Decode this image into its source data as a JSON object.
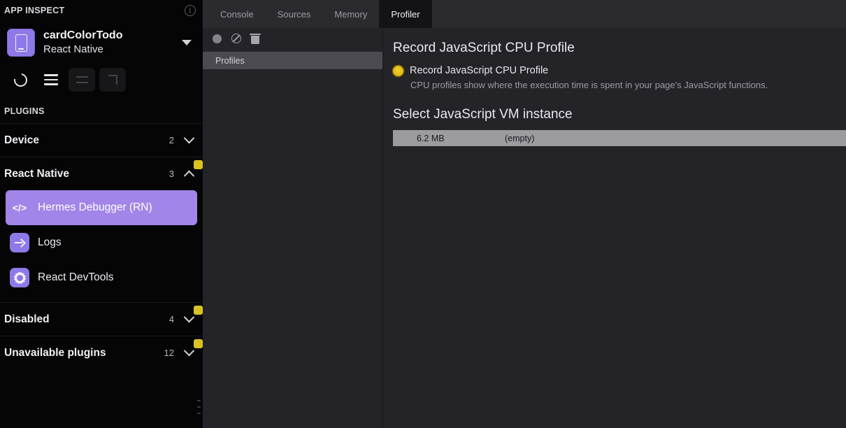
{
  "sidebar": {
    "title": "APP INSPECT",
    "info_icon": "info-icon",
    "app": {
      "name": "cardColorTodo",
      "framework": "React Native",
      "icon": "mobile-device-icon",
      "dropdown_icon": "caret-down-icon"
    },
    "toolbar": [
      {
        "name": "reload-button",
        "icon": "reload-icon",
        "disabled": false
      },
      {
        "name": "menu-button",
        "icon": "hamburger-menu-icon",
        "disabled": false
      },
      {
        "name": "layout-button",
        "icon": "layout-rows-icon",
        "disabled": true
      },
      {
        "name": "screenshot-button",
        "icon": "screen-capture-icon",
        "disabled": true
      }
    ],
    "plugins_label": "PLUGINS",
    "sections": [
      {
        "label": "Device",
        "count": "2",
        "chevron": "down",
        "badge": false
      },
      {
        "label": "React Native",
        "count": "3",
        "chevron": "up",
        "badge": true
      },
      {
        "label": "Disabled",
        "count": "4",
        "chevron": "down",
        "badge": true
      },
      {
        "label": "Unavailable plugins",
        "count": "12",
        "chevron": "down",
        "badge": true
      }
    ],
    "plugins": [
      {
        "label": "Hermes Debugger (RN)",
        "icon": "code-brackets-icon",
        "selected": true
      },
      {
        "label": "Logs",
        "icon": "arrow-right-icon",
        "selected": false
      },
      {
        "label": "React DevTools",
        "icon": "gear-atom-icon",
        "selected": false
      }
    ]
  },
  "devtools": {
    "tabs": [
      {
        "label": "Console",
        "active": false
      },
      {
        "label": "Sources",
        "active": false
      },
      {
        "label": "Memory",
        "active": false
      },
      {
        "label": "Profiler",
        "active": true
      }
    ],
    "profiles_pane": {
      "toolbar": [
        {
          "name": "record-button",
          "icon": "record-circle-icon"
        },
        {
          "name": "clear-button",
          "icon": "no-entry-icon"
        },
        {
          "name": "delete-button",
          "icon": "trash-icon"
        }
      ],
      "items": [
        {
          "label": "Profiles",
          "selected": true
        }
      ]
    },
    "panel": {
      "heading": "Record JavaScript CPU Profile",
      "radio_label": "Record JavaScript CPU Profile",
      "hint": "CPU profiles show where the execution time is spent in your page's JavaScript functions.",
      "vm_heading": "Select JavaScript VM instance",
      "vm_rows": [
        {
          "size": "6.2 MB",
          "name": "(empty)"
        }
      ]
    }
  },
  "colors": {
    "accent_purple": "#a285e8",
    "icon_purple": "#8f79e8",
    "badge_yellow": "#d9c323",
    "radio_yellow": "#e3bb12",
    "sidebar_bg": "#050506",
    "panel_bg": "#232328",
    "tabbar_bg": "#2b2b2f"
  }
}
